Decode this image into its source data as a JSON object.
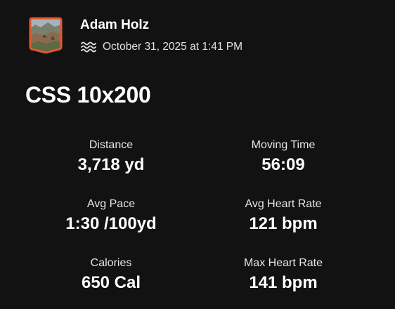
{
  "athlete": {
    "name": "Adam Holz",
    "avatar_icon": "avatar-image"
  },
  "activity": {
    "sport_icon": "swim-icon",
    "datetime": "October 31, 2025 at 1:41 PM",
    "title": "CSS 10x200"
  },
  "stats": [
    {
      "label": "Distance",
      "value": "3,718 yd"
    },
    {
      "label": "Moving Time",
      "value": "56:09"
    },
    {
      "label": "Avg Pace",
      "value": "1:30 /100yd"
    },
    {
      "label": "Avg Heart Rate",
      "value": "121 bpm"
    },
    {
      "label": "Calories",
      "value": "650 Cal"
    },
    {
      "label": "Max Heart Rate",
      "value": "141 bpm"
    }
  ],
  "colors": {
    "background": "#121212",
    "avatar_border": "#e2572c",
    "text": "#ffffff"
  }
}
